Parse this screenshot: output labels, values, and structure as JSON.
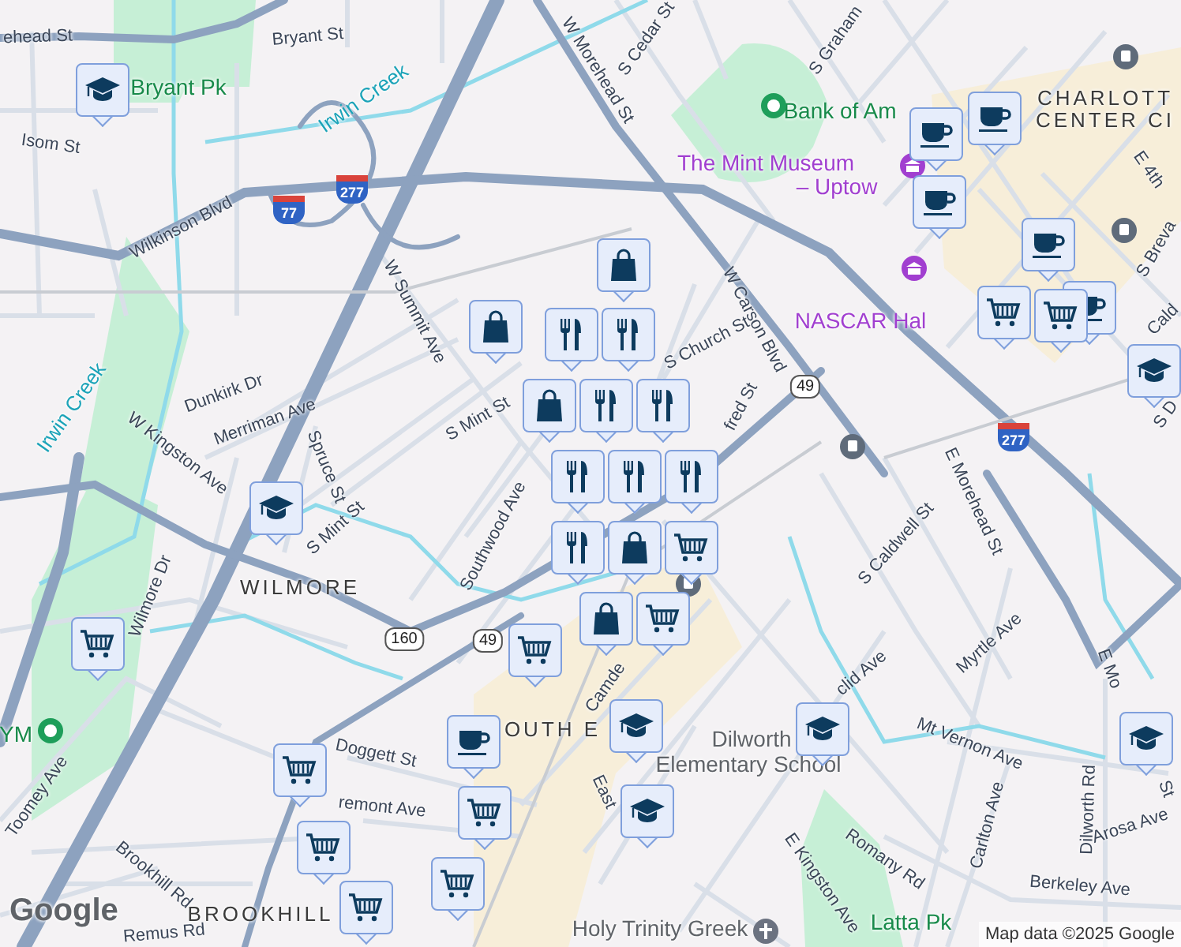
{
  "map": {
    "labels": [
      {
        "text": "ehead St",
        "kind": "street"
      },
      {
        "text": "Bryant St",
        "kind": "street"
      },
      {
        "text": "Isom St",
        "kind": "street"
      },
      {
        "text": "Wilkinson Blvd",
        "kind": "street"
      },
      {
        "text": "W Summit Ave",
        "kind": "street"
      },
      {
        "text": "W Morehead St",
        "kind": "street"
      },
      {
        "text": "S Cedar St",
        "kind": "street"
      },
      {
        "text": "S Graham",
        "kind": "street"
      },
      {
        "text": "S Church St",
        "kind": "street"
      },
      {
        "text": "W Carson Blvd",
        "kind": "street"
      },
      {
        "text": "fred St",
        "kind": "street"
      },
      {
        "text": "S Mint St",
        "kind": "street"
      },
      {
        "text": "Dunkirk Dr",
        "kind": "street"
      },
      {
        "text": "Merriman Ave",
        "kind": "street"
      },
      {
        "text": "W Kingston Ave",
        "kind": "street"
      },
      {
        "text": "Spruce St",
        "kind": "street"
      },
      {
        "text": "S Mint St",
        "kind": "street"
      },
      {
        "text": "Southwood Ave",
        "kind": "street"
      },
      {
        "text": "Wilmore Dr",
        "kind": "street"
      },
      {
        "text": "Camde",
        "kind": "street"
      },
      {
        "text": "S Caldwell St",
        "kind": "street"
      },
      {
        "text": "E Morehead St",
        "kind": "street"
      },
      {
        "text": "Myrtle Ave",
        "kind": "street"
      },
      {
        "text": "clid Ave",
        "kind": "street"
      },
      {
        "text": "Mt Vernon Ave",
        "kind": "street"
      },
      {
        "text": "Carlton Ave",
        "kind": "street"
      },
      {
        "text": "Dilworth Rd",
        "kind": "street"
      },
      {
        "text": "E Mo",
        "kind": "street"
      },
      {
        "text": "St",
        "kind": "street"
      },
      {
        "text": "Arosa Ave",
        "kind": "street"
      },
      {
        "text": "Romany Rd",
        "kind": "street"
      },
      {
        "text": "Berkeley Ave",
        "kind": "street"
      },
      {
        "text": "E Kingston Ave",
        "kind": "street"
      },
      {
        "text": "East",
        "kind": "street"
      },
      {
        "text": "Doggett St",
        "kind": "street"
      },
      {
        "text": "remont Ave",
        "kind": "street"
      },
      {
        "text": "Toomey Ave",
        "kind": "street"
      },
      {
        "text": "Brookhill Rd",
        "kind": "street"
      },
      {
        "text": "Remus Rd",
        "kind": "street"
      },
      {
        "text": "E 4th",
        "kind": "street"
      },
      {
        "text": "S Breva",
        "kind": "street"
      },
      {
        "text": "Cald",
        "kind": "street"
      },
      {
        "text": "S D",
        "kind": "street"
      },
      {
        "text": "Bryant Pk",
        "kind": "park"
      },
      {
        "text": "Irwin Creek",
        "kind": "water"
      },
      {
        "text": "Irwin Creek",
        "kind": "water"
      },
      {
        "text": "Latta Pk",
        "kind": "park"
      },
      {
        "text": "Bank of Am",
        "kind": "park"
      },
      {
        "text": "The Mint Museum",
        "kind": "attraction"
      },
      {
        "text": "– Uptow",
        "kind": "attraction"
      },
      {
        "text": "NASCAR Hal",
        "kind": "attraction"
      },
      {
        "text": "Dilworth",
        "kind": "landmark"
      },
      {
        "text": "Elementary School",
        "kind": "landmark"
      },
      {
        "text": "Holy Trinity Greek",
        "kind": "landmark"
      },
      {
        "text": "YM",
        "kind": "park"
      },
      {
        "text": "CHARLOTT",
        "kind": "district"
      },
      {
        "text": "CENTER CI",
        "kind": "district"
      },
      {
        "text": "WILMORE",
        "kind": "district"
      },
      {
        "text": "OUTH E",
        "kind": "district"
      },
      {
        "text": "BROOKHILL",
        "kind": "district"
      }
    ],
    "route_shields": [
      {
        "text": "77",
        "kind": "interstate"
      },
      {
        "text": "277",
        "kind": "interstate"
      },
      {
        "text": "49",
        "kind": "state"
      },
      {
        "text": "160",
        "kind": "state"
      },
      {
        "text": "49",
        "kind": "state"
      },
      {
        "text": "277",
        "kind": "interstate"
      }
    ],
    "markers": [
      {
        "kind": "school"
      },
      {
        "kind": "school"
      },
      {
        "kind": "school"
      },
      {
        "kind": "school"
      },
      {
        "kind": "school"
      },
      {
        "kind": "school"
      },
      {
        "kind": "school"
      },
      {
        "kind": "shopping"
      },
      {
        "kind": "shopping"
      },
      {
        "kind": "restaurant"
      },
      {
        "kind": "restaurant"
      },
      {
        "kind": "restaurant"
      },
      {
        "kind": "restaurant"
      },
      {
        "kind": "restaurant"
      },
      {
        "kind": "restaurant"
      },
      {
        "kind": "restaurant"
      },
      {
        "kind": "restaurant"
      },
      {
        "kind": "shopping"
      },
      {
        "kind": "shopping"
      },
      {
        "kind": "shopping"
      },
      {
        "kind": "cafe"
      },
      {
        "kind": "cafe"
      },
      {
        "kind": "cafe"
      },
      {
        "kind": "cafe"
      },
      {
        "kind": "cafe"
      },
      {
        "kind": "cafe"
      },
      {
        "kind": "grocery"
      },
      {
        "kind": "grocery"
      },
      {
        "kind": "grocery"
      },
      {
        "kind": "grocery"
      },
      {
        "kind": "grocery"
      },
      {
        "kind": "grocery"
      },
      {
        "kind": "grocery"
      },
      {
        "kind": "grocery"
      },
      {
        "kind": "grocery"
      },
      {
        "kind": "grocery"
      },
      {
        "kind": "grocery"
      }
    ]
  },
  "logo": "Google",
  "attribution": "Map data ©2025 Google"
}
